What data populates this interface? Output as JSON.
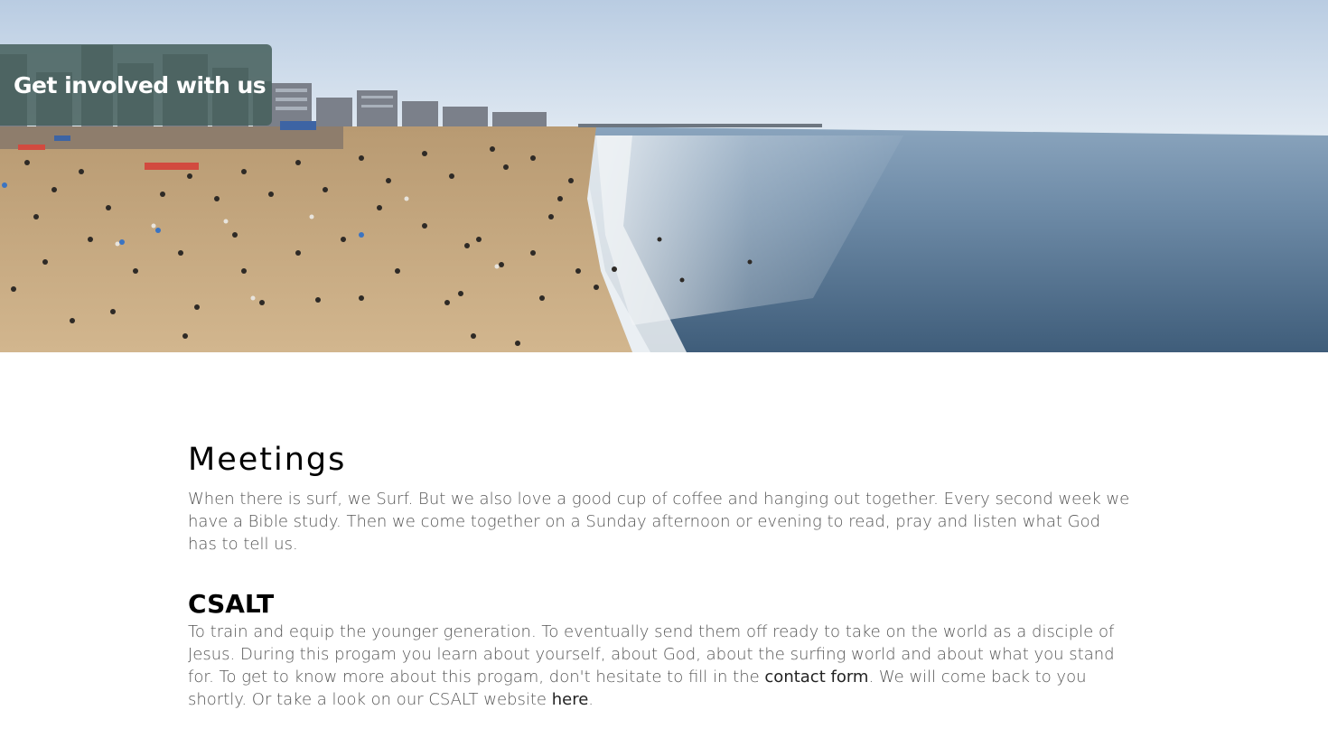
{
  "hero": {
    "badge_label": "Get involved with us",
    "image_alt": "beach-photo"
  },
  "meetings": {
    "title": "Meetings",
    "text": "When there is surf, we Surf. But we also love a good cup of coffee and hanging out together. Every second week we have a Bible study. Then we come together on a Sunday afternoon or evening to read, pray and listen what God has to tell us."
  },
  "csalt": {
    "title": "CSALT",
    "text_part1": "To train and equip the younger generation. To eventually send them off ready to take on the world as a disciple of Jesus. During this progam you learn about yourself, about God, about the surfing world and about what you stand for. To get to know more about this progam, don't hesitate to fill in the ",
    "contact_link": "contact form",
    "text_part2": ". We will come back to you shortly. Or take a look on our CSALT website ",
    "here_link": "here",
    "text_part3": "."
  },
  "colors": {
    "badge_bg": "#46605c",
    "sky": "#cfdcea",
    "sea": "#4f6f8e",
    "sand": "#c9ad85",
    "text": "#555555"
  }
}
